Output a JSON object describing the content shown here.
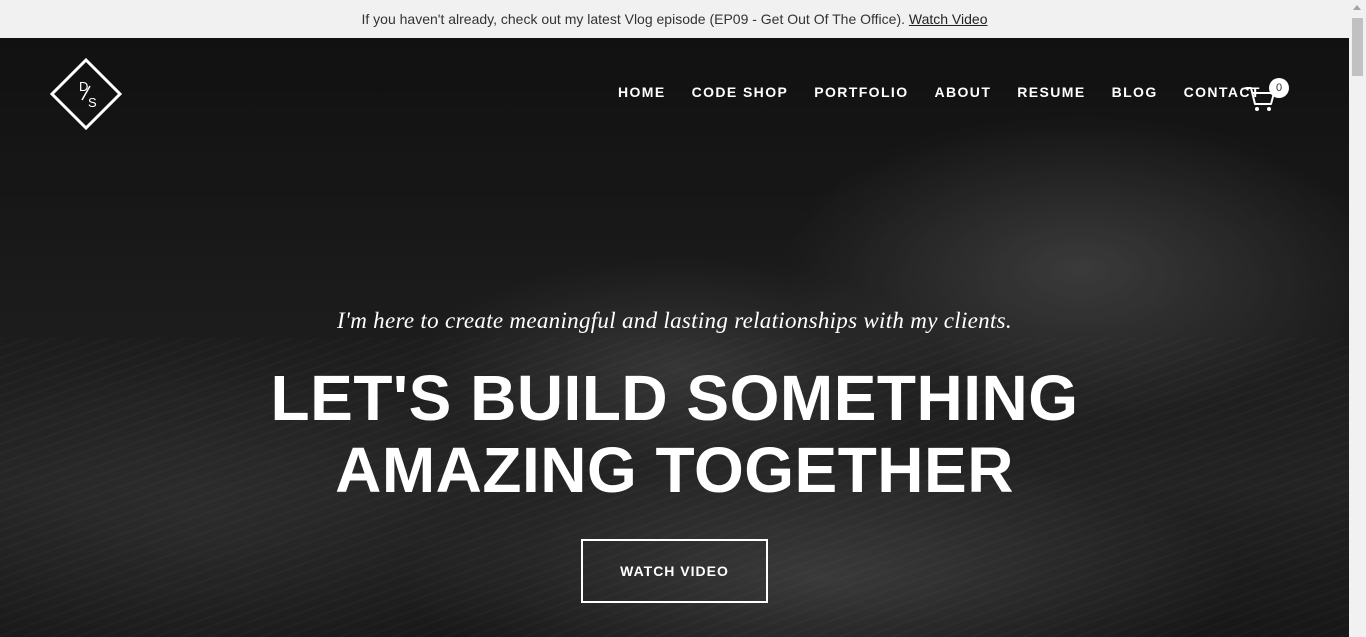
{
  "announcement": {
    "text": "If you haven't already, check out my latest Vlog episode (EP09 - Get Out Of The Office).",
    "link_label": "Watch Video"
  },
  "logo": {
    "letter_top": "D",
    "letter_bottom": "S",
    "icon": "diamond-logo-icon"
  },
  "nav": {
    "items": [
      {
        "label": "HOME"
      },
      {
        "label": "CODE SHOP"
      },
      {
        "label": "PORTFOLIO"
      },
      {
        "label": "ABOUT"
      },
      {
        "label": "RESUME"
      },
      {
        "label": "BLOG"
      },
      {
        "label": "CONTACT"
      }
    ],
    "cart": {
      "icon": "cart-icon",
      "count": "0"
    }
  },
  "hero": {
    "tagline": "I'm here to create meaningful and lasting relationships with my clients.",
    "headline_line1": "LET'S BUILD SOMETHING",
    "headline_line2": "AMAZING TOGETHER",
    "cta_label": "WATCH VIDEO"
  },
  "colors": {
    "announce_bg": "#f1f1f1",
    "hero_text": "#ffffff",
    "hero_bg": "#1f1f1f"
  }
}
